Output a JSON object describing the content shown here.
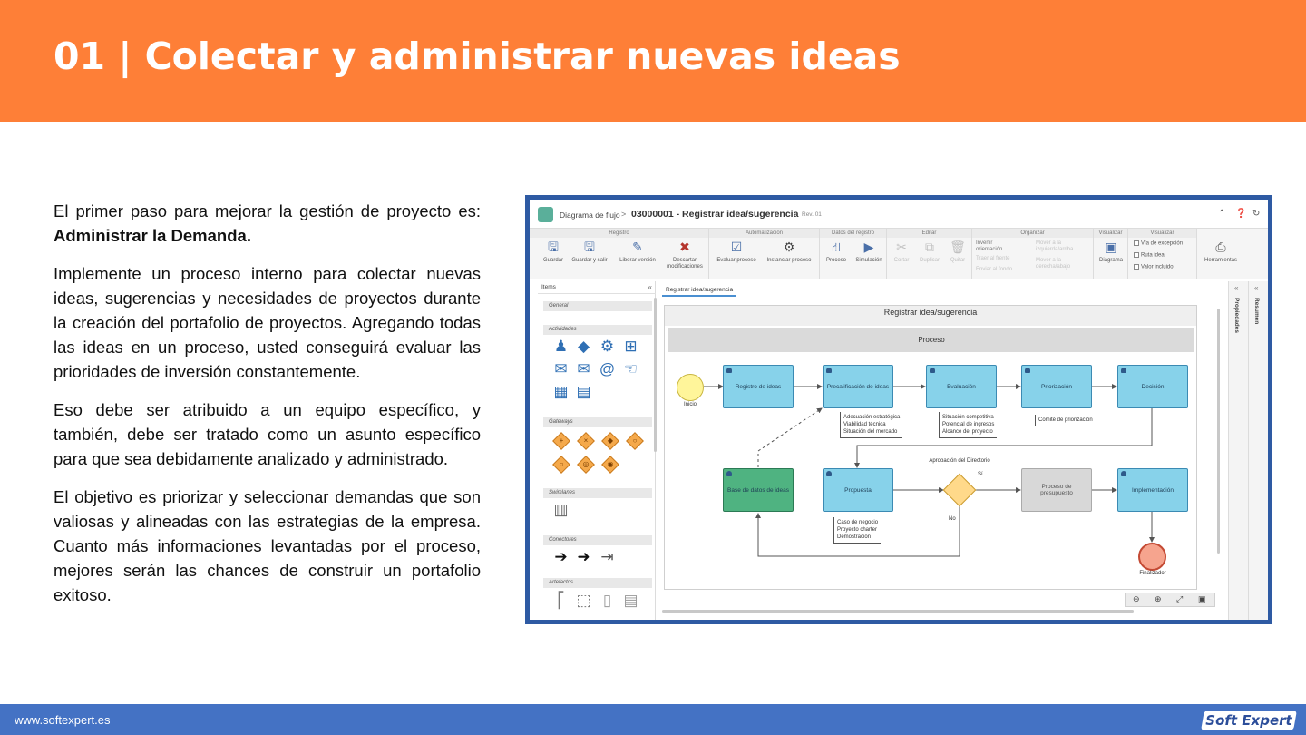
{
  "slide": {
    "title": "01 | Colectar y administrar nuevas ideas",
    "paragraphs": {
      "p1_text": "El primer paso para mejorar la gestión de proyecto es:",
      "p1_bold": "Administrar la Demanda.",
      "p2": "Implemente un proceso interno para colectar nuevas ideas, sugerencias y necesidades de proyectos durante la creación del portafolio de proyectos. Agregando todas las ideas en un proceso, usted conseguirá evaluar las prioridades de inversión constantemente.",
      "p3": "Eso debe ser atribuido a un equipo específico, y también, debe ser tratado como un asunto específico para que sea debidamente analizado y administrado.",
      "p4": "El objetivo es priorizar y seleccionar demandas que son valiosas y alineadas con las estrategias de la empresa. Cuanto más informaciones levantadas por el proceso, mejores serán las chances de construir un portafolio exitoso."
    },
    "footer_url": "www.softexpert.es",
    "logo_text": "Soft Expert",
    "colors": {
      "header": "#fe7f37",
      "footer": "#4472c4",
      "frame": "#2e5aa3"
    }
  },
  "app": {
    "breadcrumb": "Diagrama de flujo",
    "breadcrumb_sep": ">",
    "document_title": "03000001 - Registrar idea/sugerencia",
    "revision": "Rev. 01",
    "title_icons": [
      "collapse-up-icon",
      "help-icon",
      "refresh-icon"
    ],
    "ribbon": {
      "groups": {
        "registro": "Registro",
        "automatizacion": "Automatización",
        "datos": "Datos del registro",
        "editar": "Editar",
        "organizar": "Organizar",
        "visualizar1": "Visualizar",
        "visualizar2": "Visualizar"
      },
      "buttons": {
        "guardar": "Guardar",
        "guardar_salir": "Guardar y salir",
        "liberar": "Liberar versión",
        "descartar1": "Descartar",
        "descartar2": "modificaciones",
        "evaluar": "Evaluar proceso",
        "instanciar": "Instanciar proceso",
        "proceso": "Proceso",
        "simulacion": "Simulación",
        "cortar": "Cortar",
        "duplicar": "Duplicar",
        "quitar": "Quitar",
        "diagrama": "Diagrama",
        "herramientas": "Herramientas"
      },
      "organizar": {
        "invertir1": "Invertir",
        "invertir2": "orientación",
        "traer": "Traer al frente",
        "enviar": "Enviar al fondo",
        "mover_izq1": "Mover a la",
        "mover_izq2": "izquierda/arriba",
        "mover_der1": "Mover a la",
        "mover_der2": "derecha/abajo"
      },
      "checks": {
        "via": "Vía de excepción",
        "ruta": "Ruta ideal",
        "valor": "Valor incluido"
      }
    },
    "items_panel": {
      "title": "Items",
      "categories": {
        "general": "General",
        "actividades": "Actividades",
        "gateways": "Gateways",
        "swimlanes": "Swimlanes",
        "conectores": "Conectores",
        "artefactos": "Artefactos"
      }
    },
    "canvas": {
      "tab": "Registrar idea/sugerencia",
      "pool": "Registrar idea/sugerencia",
      "lane": "Proceso",
      "start": "Inicio",
      "end": "Finalizador",
      "tasks": {
        "registro": "Registro de ideas",
        "precalificacion": "Precalificación de ideas",
        "evaluacion": "Evaluación",
        "priorizacion": "Priorización",
        "decision": "Decisión",
        "base": "Base de datos de ideas",
        "propuesta": "Propuesta",
        "presupuesto": "Proceso de presupuesto",
        "implementacion": "Implementación"
      },
      "gateway_label": "Aprobación del Directorio",
      "yes": "Sí",
      "no": "No",
      "notes": {
        "n1a": "Adecuación estratégica",
        "n1b": "Viabilidad técnica",
        "n1c": "Situación del mercado",
        "n2a": "Situación competitiva",
        "n2b": "Potencial de ingresos",
        "n2c": "Alcance del proyecto",
        "n3": "Comité de priorización",
        "n4a": "Caso de negocio",
        "n4b": "Proyecto charter",
        "n4c": "Demostración"
      }
    },
    "side_panels": {
      "propiedades": "Propiedades",
      "resumen": "Resumen"
    }
  }
}
